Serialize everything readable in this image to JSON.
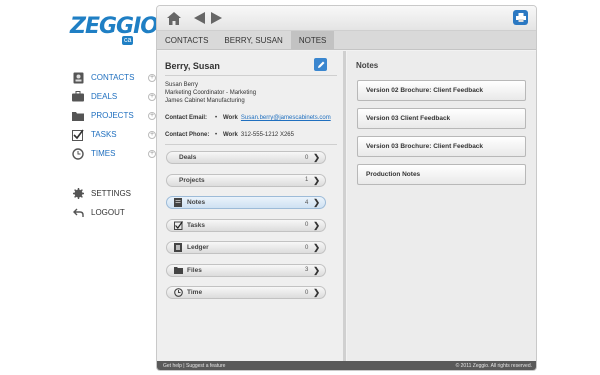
{
  "brand": {
    "logo_text": "ZEGGIO",
    "logo_badge": "ca",
    "accent": "#1f7fc4"
  },
  "nav": {
    "items": [
      {
        "label": "CONTACTS",
        "icon": "contacts-icon"
      },
      {
        "label": "DEALS",
        "icon": "briefcase-icon"
      },
      {
        "label": "PROJECTS",
        "icon": "folder-icon"
      },
      {
        "label": "TASKS",
        "icon": "checkbox-icon"
      },
      {
        "label": "TIMES",
        "icon": "clock-icon"
      }
    ],
    "settings_label": "SETTINGS",
    "logout_label": "LOGOUT"
  },
  "breadcrumb": [
    "CONTACTS",
    "BERRY, SUSAN",
    "NOTES"
  ],
  "contact": {
    "name": "Berry, Susan",
    "line1": "Susan Berry",
    "line2": "Marketing Coordinator - Marketing",
    "line3": "James Cabinet Manufacturing",
    "email_label": "Contact Email:",
    "email_type": "Work",
    "email_value": "Susan.berry@jamescabinets.com",
    "phone_label": "Contact Phone:",
    "phone_type": "Work",
    "phone_value": "312-555-1212 X265"
  },
  "sections": [
    {
      "label": "Deals",
      "count": "0",
      "icon": "",
      "active": false
    },
    {
      "label": "Projects",
      "count": "1",
      "icon": "",
      "active": false
    },
    {
      "label": "Notes",
      "count": "4",
      "icon": "note-icon",
      "active": true
    },
    {
      "label": "Tasks",
      "count": "0",
      "icon": "checkbox-icon",
      "active": false
    },
    {
      "label": "Ledger",
      "count": "0",
      "icon": "ledger-icon",
      "active": false
    },
    {
      "label": "Files",
      "count": "3",
      "icon": "folder-icon",
      "active": false
    },
    {
      "label": "Time",
      "count": "0",
      "icon": "clock-icon",
      "active": false
    }
  ],
  "notes": {
    "title": "Notes",
    "items": [
      "Version 02 Brochure: Client Feedback",
      "Version 03 Client Feedback",
      "Version 03 Brochure: Client Feedback",
      "Production Notes"
    ]
  },
  "footer": {
    "left": "Get help | Suggest a feature",
    "right": "© 2011 Zeggio. All rights reserved."
  }
}
